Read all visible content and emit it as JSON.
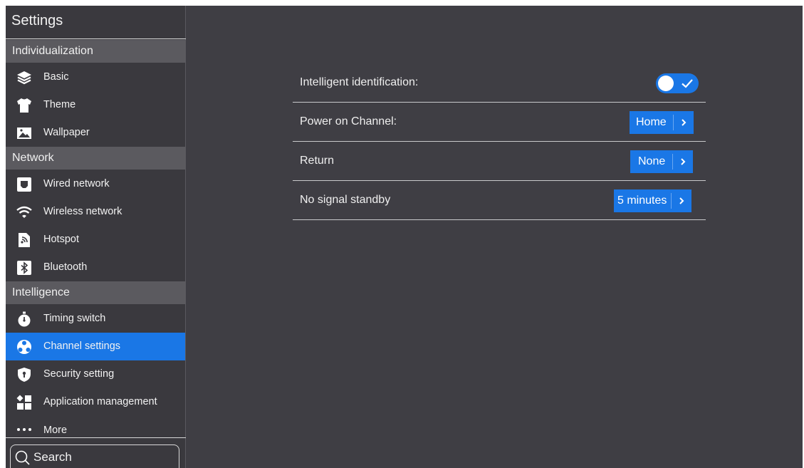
{
  "sidebar": {
    "title": "Settings",
    "sections": {
      "individualization": "Individualization",
      "network": "Network",
      "intelligence": "Intelligence"
    },
    "items": {
      "basic": "Basic",
      "theme": "Theme",
      "wallpaper": "Wallpaper",
      "wired": "Wired network",
      "wireless": "Wireless network",
      "hotspot": "Hotspot",
      "bluetooth": "Bluetooth",
      "timing": "Timing switch",
      "channel": "Channel settings",
      "security": "Security setting",
      "apps": "Application management",
      "more": "More"
    },
    "active_item": "Channel settings",
    "search_label": "Search"
  },
  "main": {
    "rows": {
      "intelligent": {
        "label": "Intelligent identification:",
        "toggle_on": true
      },
      "power_on": {
        "label": "Power on Channel:",
        "value": "Home"
      },
      "return": {
        "label": "Return",
        "value": "None"
      },
      "standby": {
        "label": "No signal standby",
        "value": "5 minutes"
      }
    }
  },
  "colors": {
    "accent": "#1a77e6",
    "background": "#3f3e44",
    "sidebar": "#3a393e",
    "section_header": "#5b5a5f"
  }
}
